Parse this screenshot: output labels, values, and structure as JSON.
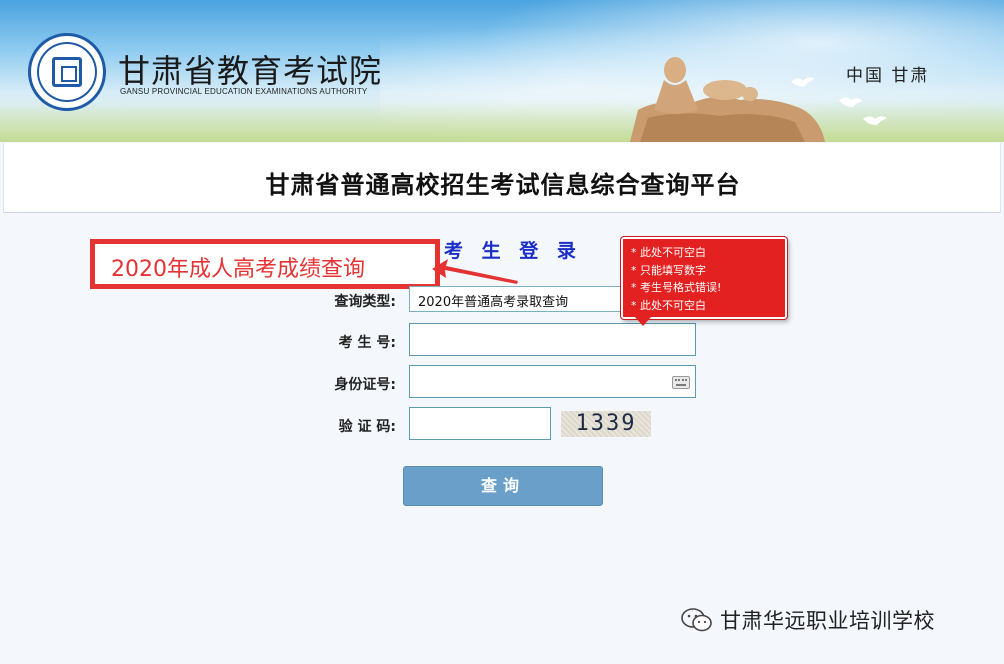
{
  "header": {
    "org_name": "甘肃省教育考试院",
    "org_name_en": "GANSU PROVINCIAL EDUCATION EXAMINATIONS AUTHORITY",
    "region": "中国  甘肃"
  },
  "platform_title": "甘肃省普通高校招生考试信息综合查询平台",
  "login": {
    "heading": "考 生 登 录",
    "query_type_label": "查询类型:",
    "query_type_value": "2020年普通高考录取查询",
    "exam_no_label": "考 生 号:",
    "exam_no_value": "",
    "id_label": "身份证号:",
    "id_value": "",
    "captcha_label": "验 证 码:",
    "captcha_value": "",
    "captcha_image_text": "1339",
    "submit_label": "查询"
  },
  "annotation": {
    "text": "2020年成人高考成绩查询"
  },
  "validation_tooltip": {
    "messages": [
      "此处不可空白",
      "只能填写数字",
      "考生号格式错误!",
      "此处不可空白"
    ]
  },
  "watermark": {
    "text": "甘肃华远职业培训学校",
    "icon": "wechat-icon"
  },
  "colors": {
    "heading_blue": "#1a2ec8",
    "annotation_red": "#e53333",
    "tooltip_red": "#e42121",
    "button_blue": "#6a9fc9"
  }
}
